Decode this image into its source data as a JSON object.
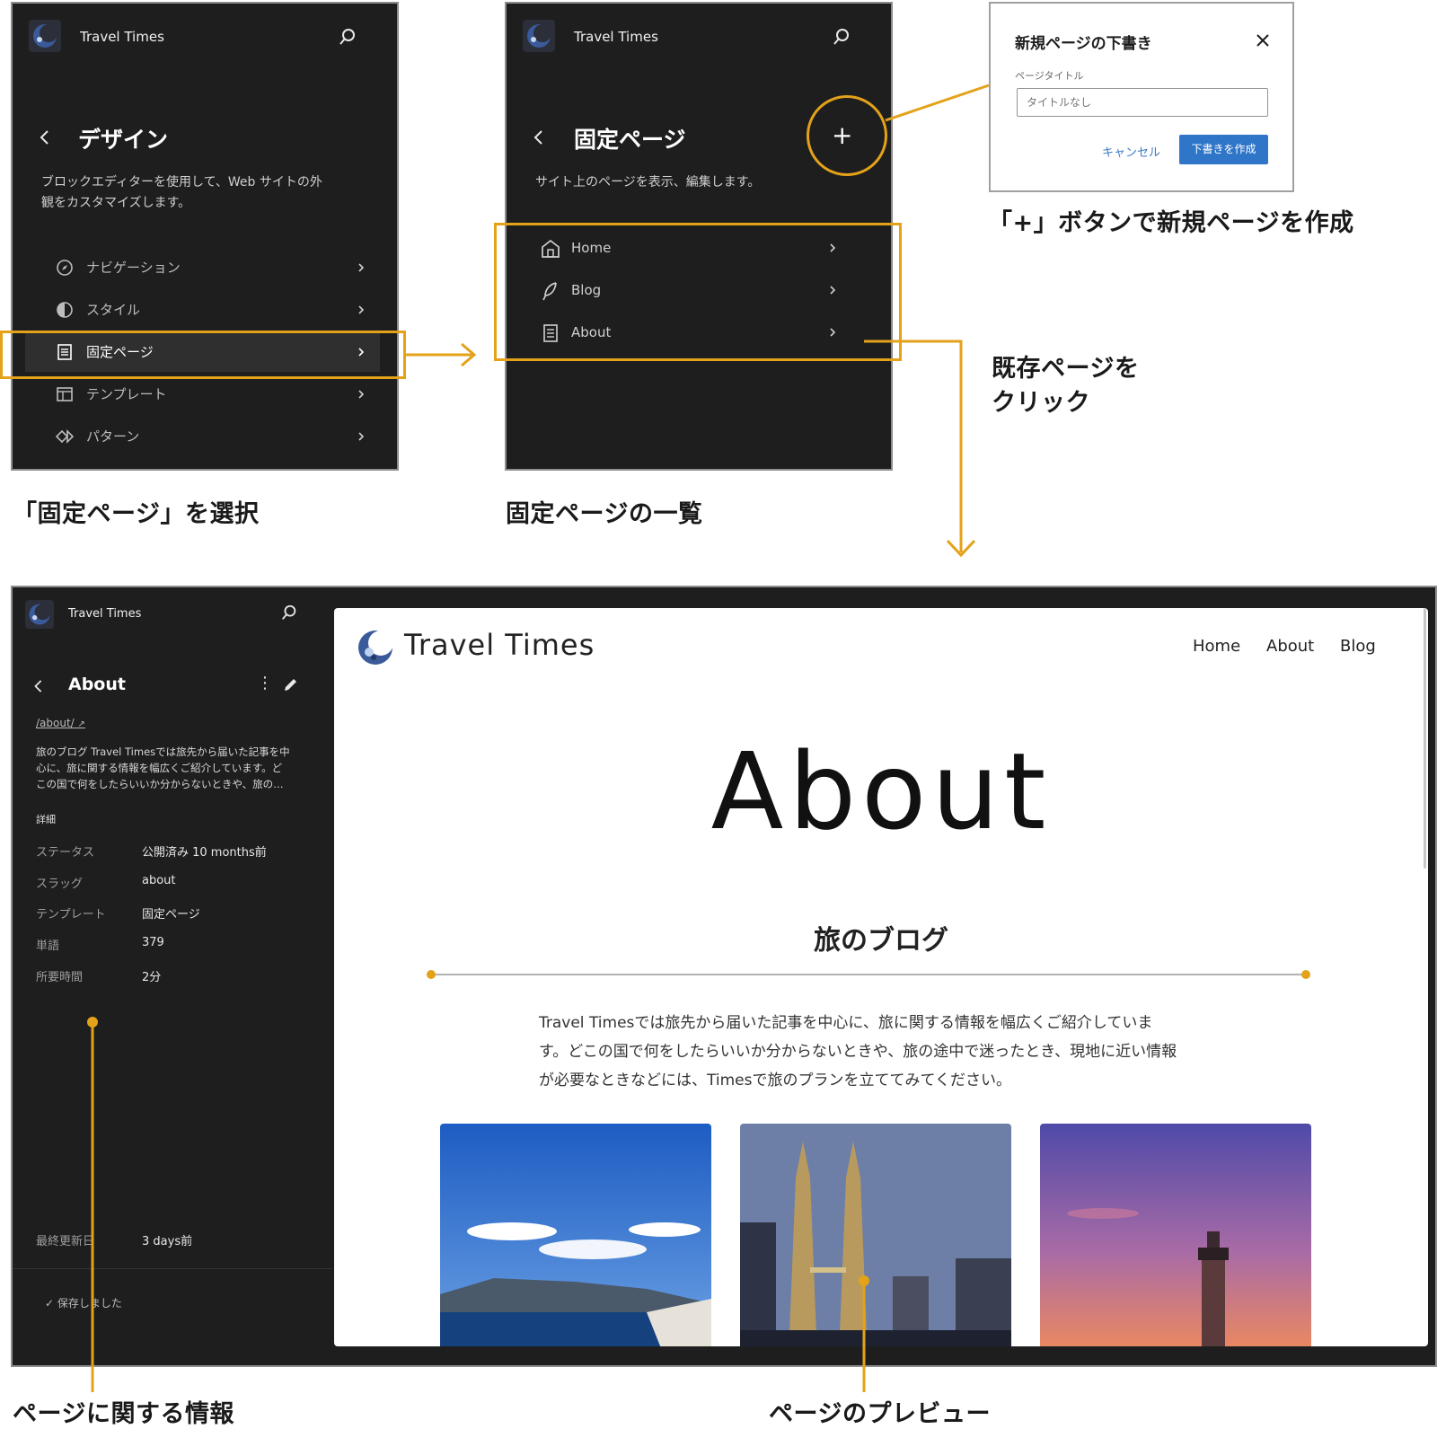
{
  "site": {
    "name": "Travel Times"
  },
  "panel1": {
    "title": "デザイン",
    "desc_line1": "ブロックエディターを使用して、Web サイトの外",
    "desc_line2": "観をカスタマイズします。",
    "items": [
      {
        "label": "ナビゲーション",
        "icon": "navigation-icon"
      },
      {
        "label": "スタイル",
        "icon": "styles-icon"
      },
      {
        "label": "固定ページ",
        "icon": "page-icon"
      },
      {
        "label": "テンプレート",
        "icon": "template-icon"
      },
      {
        "label": "パターン",
        "icon": "pattern-icon"
      }
    ]
  },
  "panel2": {
    "title": "固定ページ",
    "desc": "サイト上のページを表示、編集します。",
    "add_label": "+",
    "pages": [
      {
        "label": "Home",
        "icon": "home-icon"
      },
      {
        "label": "Blog",
        "icon": "feather-icon"
      },
      {
        "label": "About",
        "icon": "page-icon"
      }
    ]
  },
  "dialog": {
    "title": "新規ページの下書き",
    "field_label": "ページタイトル",
    "placeholder": "タイトルなし",
    "cancel": "キャンセル",
    "create": "下書きを作成"
  },
  "captions": {
    "select_page": "「固定ページ」を選択",
    "page_list": "固定ページの一覧",
    "new_page": "「+」ボタンで新規ページを作成",
    "click_existing_1": "既存ページを",
    "click_existing_2": "クリック",
    "page_info": "ページに関する情報",
    "page_preview": "ページのプレビュー"
  },
  "editor": {
    "title": "About",
    "link": "/about/",
    "excerpt_1": "旅のブログ Travel Timesでは旅先から届いた記事を中",
    "excerpt_2": "心に、旅に関する情報を幅広くご紹介しています。ど",
    "excerpt_3": "この国で何をしたらいいか分からないときや、旅の…",
    "details_heading": "詳細",
    "details": [
      {
        "label": "ステータス",
        "value": "公開済み 10 months前"
      },
      {
        "label": "スラッグ",
        "value": "about"
      },
      {
        "label": "テンプレート",
        "value": "固定ページ"
      },
      {
        "label": "単語",
        "value": "379"
      },
      {
        "label": "所要時間",
        "value": "2分"
      }
    ],
    "last_updated_label": "最終更新日",
    "last_updated_value": "3 days前",
    "saved": "保存しました"
  },
  "preview": {
    "site_name": "Travel Times",
    "nav": [
      "Home",
      "About",
      "Blog"
    ],
    "title": "About",
    "subtitle": "旅のブログ",
    "body_1": "Travel Timesでは旅先から届いた記事を中心に、旅に関する情報を幅広くご紹介していま",
    "body_2": "す。どこの国で何をしたらいいか分からないときや、旅の途中で迷ったとき、現地に近い情報",
    "body_3": "が必要なときなどには、Timesで旅のプランを立ててみてください。"
  },
  "colors": {
    "accent": "#e3a21a",
    "panel_bg": "#1e1e1e",
    "primary_button": "#2f75c8"
  }
}
